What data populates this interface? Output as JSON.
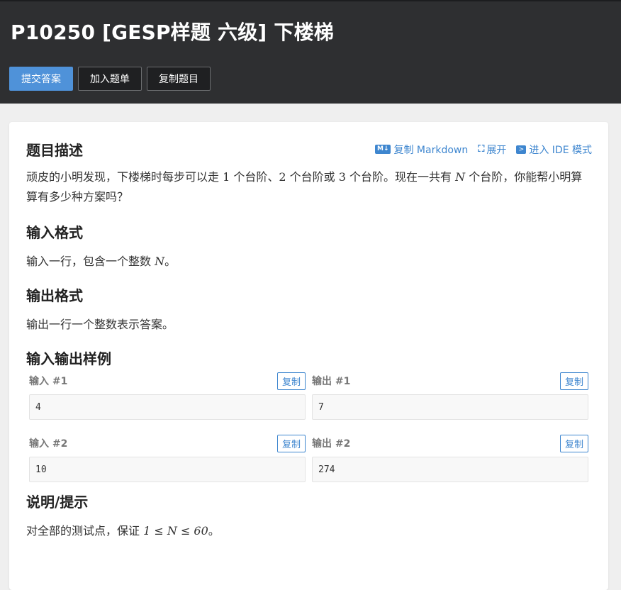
{
  "problem": {
    "title": "P10250 [GESP样题 六级] 下楼梯"
  },
  "actions": {
    "submit": "提交答案",
    "add_to_list": "加入题单",
    "copy_problem": "复制题目"
  },
  "tools": {
    "md_badge": "M↓",
    "copy_markdown": "复制 Markdown",
    "expand": "展开",
    "ide_mode": "进入 IDE 模式"
  },
  "sections": {
    "description_title": "题目描述",
    "description_1": "顽皮的小明发现，下楼梯时每步可以走 ",
    "description_n1": "1",
    "description_2": " 个台阶、",
    "description_n2": "2",
    "description_3": " 个台阶或 ",
    "description_n3": "3",
    "description_4": " 个台阶。现在一共有 ",
    "description_var": "N",
    "description_5": " 个台阶，你能帮小明算算有多少种方案吗？",
    "input_title": "输入格式",
    "input_text_1": "输入一行，包含一个整数 ",
    "input_var": "N",
    "input_text_2": "。",
    "output_title": "输出格式",
    "output_text": "输出一行一个整数表示答案。",
    "samples_title": "输入输出样例",
    "hint_title": "说明/提示",
    "hint_text_1": "对全部的测试点，保证 ",
    "hint_formula": "1 ≤ N ≤ 60",
    "hint_text_2": "。"
  },
  "samples": [
    {
      "in_label": "输入 #1",
      "in_value": "4",
      "out_label": "输出 #1",
      "out_value": "7"
    },
    {
      "in_label": "输入 #2",
      "in_value": "10",
      "out_label": "输出 #2",
      "out_value": "274"
    }
  ],
  "copy_label": "复制"
}
